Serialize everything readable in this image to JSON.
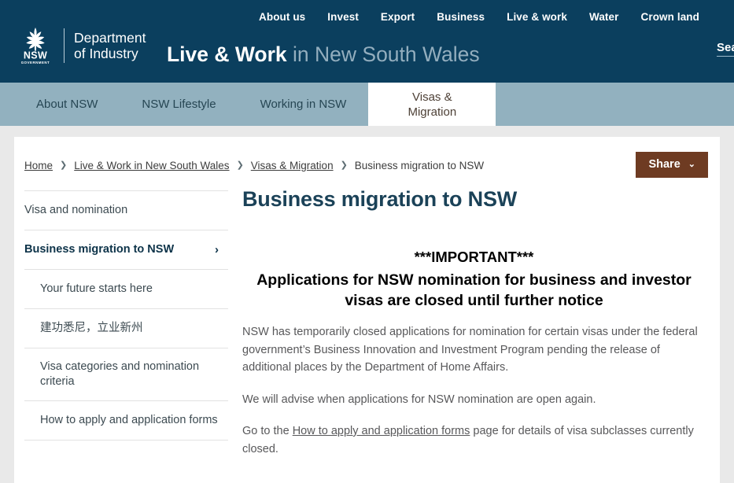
{
  "header": {
    "utility_nav": [
      {
        "label": "About us"
      },
      {
        "label": "Invest"
      },
      {
        "label": "Export"
      },
      {
        "label": "Business"
      },
      {
        "label": "Live & work"
      },
      {
        "label": "Water"
      },
      {
        "label": "Crown land"
      }
    ],
    "search_label": "Search",
    "brand": {
      "logo_icon": "nsw-waratah-logo",
      "government_text": "NSW GOVERNMENT",
      "department_name": "Department\nof Industry"
    },
    "site_title_bold": "Live & Work",
    "site_title_light": " in New South Wales",
    "colors": {
      "header_bg": "#0b3f5e",
      "nav_bg": "#92b1bf",
      "accent_brown": "#6e3b22"
    }
  },
  "main_nav": {
    "items": [
      {
        "label": "About NSW",
        "active": false
      },
      {
        "label": "NSW Lifestyle",
        "active": false
      },
      {
        "label": "Working in NSW",
        "active": false
      },
      {
        "label": "Visas &\nMigration",
        "active": true
      }
    ]
  },
  "breadcrumb": {
    "items": [
      {
        "label": "Home",
        "link": true
      },
      {
        "label": "Live & Work in New South Wales",
        "link": true
      },
      {
        "label": "Visas & Migration",
        "link": true
      },
      {
        "label": "Business migration to NSW",
        "link": false
      }
    ],
    "separator": "❯"
  },
  "share": {
    "label": "Share",
    "chevron_icon": "chevron-down-icon",
    "chevron_glyph": "⌄"
  },
  "sidebar": {
    "items": [
      {
        "label": "Visa and nomination",
        "active": false,
        "child": false,
        "chevron": false
      },
      {
        "label": "Business migration to NSW",
        "active": true,
        "child": false,
        "chevron": true
      },
      {
        "label": "Your future starts here",
        "active": false,
        "child": true,
        "chevron": false
      },
      {
        "label": "建功悉尼，立业新州",
        "active": false,
        "child": true,
        "chevron": false
      },
      {
        "label": "Visa categories and nomination criteria",
        "active": false,
        "child": true,
        "chevron": false
      },
      {
        "label": "How to apply and application forms",
        "active": false,
        "child": true,
        "chevron": false
      }
    ],
    "chevron_glyph": "›"
  },
  "main": {
    "page_title": "Business migration to NSW",
    "notice_line1": "***IMPORTANT***",
    "notice_line2": "Applications for NSW nomination for business and investor visas are closed until further notice",
    "paragraph1": "NSW has temporarily closed applications for nomination for certain visas under the federal government’s Business Innovation and Investment Program pending the release of additional places by the Department of Home Affairs.",
    "paragraph2": "We will advise when applications for NSW nomination are open again.",
    "paragraph3_pre": "Go to the ",
    "paragraph3_link": "How to apply and application forms",
    "paragraph3_post": " page for details of visa subclasses currently closed."
  }
}
